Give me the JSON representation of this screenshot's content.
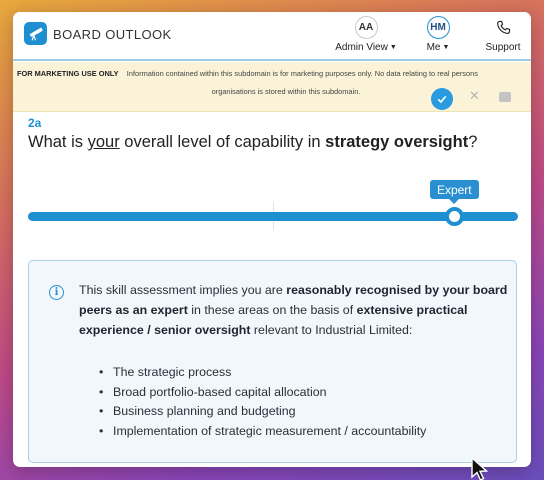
{
  "app": {
    "brand": "BOARD OUTLOOK",
    "accent_color": "#1e8fd0"
  },
  "nav": {
    "admin": {
      "avatar": "AA",
      "label": "Admin View"
    },
    "me": {
      "avatar": "HM",
      "label": "Me"
    },
    "support": {
      "label": "Support",
      "icon": "phone-icon"
    }
  },
  "banner": {
    "tag": "FOR MARKETING USE ONLY",
    "line1": "Information contained within this subdomain is for marketing purposes only. No data relating to real persons",
    "line2": "organisations is stored within this subdomain."
  },
  "question": {
    "number": "2a",
    "prefix": "What is ",
    "underlined": "your",
    "middle": " overall level of capability in ",
    "bold": "strategy oversight",
    "suffix": "?"
  },
  "slider": {
    "selected_label": "Expert",
    "value_fraction": 0.87
  },
  "info": {
    "t1": "This skill assessment implies you are ",
    "b1": "reasonably recognised by your board peers as an expert",
    "t2": " in these areas on the basis of ",
    "b2": "extensive practical experience / senior oversight",
    "t3": " relevant to Industrial Limited:",
    "bullets": [
      "The strategic process",
      "Broad portfolio-based capital allocation",
      "Business planning and budgeting",
      "Implementation of strategic measurement / accountability"
    ]
  }
}
